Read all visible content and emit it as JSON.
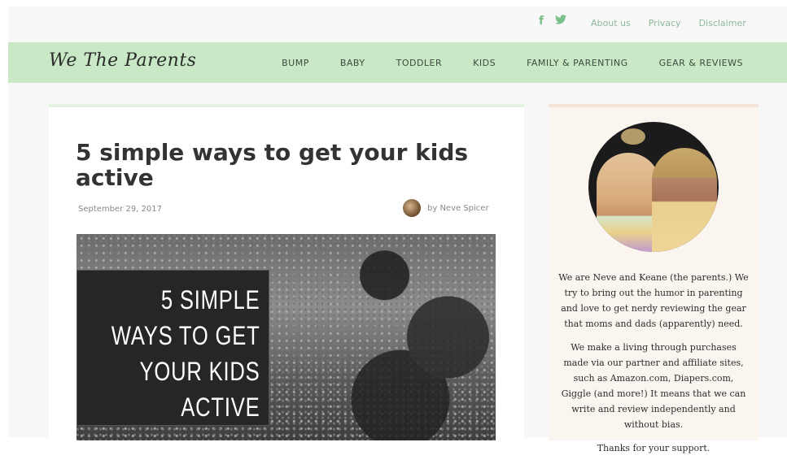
{
  "topbar": {
    "social": [
      "f",
      "🐦"
    ],
    "links": [
      "About us",
      "Privacy",
      "Disclaimer"
    ]
  },
  "navbar": {
    "logo": "We The Parents",
    "menu": [
      "BUMP",
      "BABY",
      "TODDLER",
      "KIDS",
      "FAMILY & PARENTING",
      "GEAR & REVIEWS"
    ]
  },
  "article": {
    "title": "5 simple ways to get your kids active",
    "date": "September 29, 2017",
    "author": "by Neve Spicer",
    "hero_caption": "5 SIMPLE\nWAYS TO GET\nYOUR KIDS\nACTIVE"
  },
  "sidebar": {
    "paragraph1": "We are Neve and Keane (the parents.) We try to bring out the humor in parenting and love to get nerdy reviewing the gear that moms and dads (apparently) need.",
    "paragraph2": "We make a living through purchases made via our partner and affiliate sites, such as Amazon.com, Diapers.com, Giggle (and more!) It means that we can write and review independently and without bias.",
    "paragraph3": "Thanks for your support."
  },
  "colors": {
    "nav_bg": "#c9e9c6",
    "accent_green": "#7cbf8a",
    "sidebar_bg": "#fbf5ef"
  }
}
